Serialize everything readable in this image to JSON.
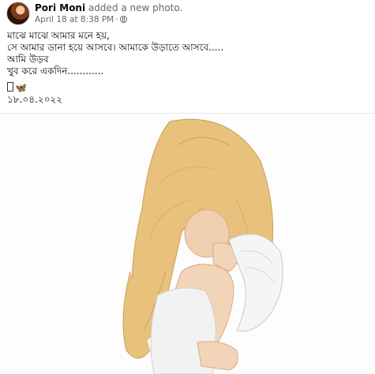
{
  "post": {
    "author": "Pori Moni",
    "action": "added a new photo.",
    "timestamp": "April 18 at 8:38 PM",
    "separator": "·",
    "privacy_icon": "globe-icon",
    "text_lines": [
      "মাঝে মাঝে আমার মনে হয়,",
      "সে আমার ডানা হয়ে আসবে। আমাকে উড়াতে আসবে.....",
      "আমি উড়ব",
      "খুব করে একদিন............"
    ],
    "emoji": "🦋",
    "emoji_icon": "butterfly-icon",
    "date_text": "১৮.০৪.২০২২"
  },
  "photo": {
    "subject": "illustration",
    "colors": {
      "hair": "#e9c37a",
      "skin": "#f2d4b8",
      "dress": "#f3f3f3",
      "wing": "#f7f7f7"
    }
  }
}
